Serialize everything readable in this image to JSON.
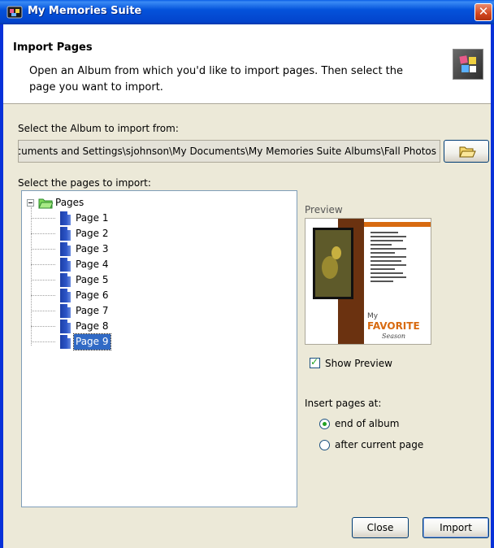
{
  "window": {
    "title": "My Memories Suite",
    "close_glyph": "✕",
    "app_icon": "app-icon"
  },
  "header": {
    "title": "Import Pages",
    "description": "Open an Album from which you'd like to import pages. Then select the page you want to import.",
    "icon": "import-pages-icon"
  },
  "album": {
    "label": "Select the Album to import from:",
    "path": "Documents and Settings\\sjohnson\\My Documents\\My Memories Suite Albums\\Fall Photos",
    "browse_icon": "open-folder-icon"
  },
  "pages": {
    "label": "Select the pages to import:",
    "root_label": "Pages",
    "items": [
      "Page 1",
      "Page 2",
      "Page 3",
      "Page 4",
      "Page 5",
      "Page 6",
      "Page 7",
      "Page 8",
      "Page 9"
    ],
    "selected": "Page 9"
  },
  "preview": {
    "label": "Preview",
    "page_text": [
      "My",
      "FAVORITE",
      "Season"
    ],
    "colors": {
      "bar": "#6B3210",
      "accent": "#D86A10"
    }
  },
  "show_preview": {
    "label": "Show Preview",
    "checked": true
  },
  "insert": {
    "label": "Insert pages at:",
    "options": [
      "end of album",
      "after current page"
    ],
    "selected": "end of album"
  },
  "buttons": {
    "close": "Close",
    "import": "Import"
  },
  "colors": {
    "titlebar": "#0453DB",
    "selection": "#316AC5",
    "dialog_bg": "#ECE9D8"
  }
}
